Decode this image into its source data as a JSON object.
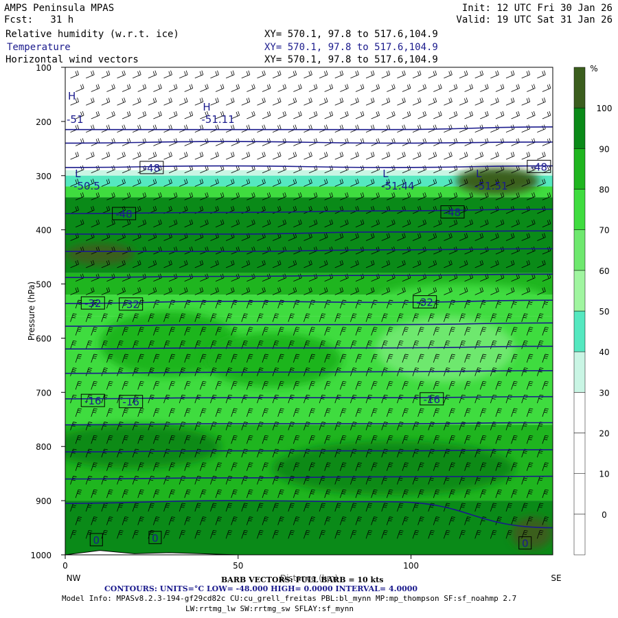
{
  "header": {
    "model": "AMPS Peninsula MPAS",
    "fcst": "Fcst:   31 h",
    "init": "Init: 12 UTC Fri 30 Jan 26",
    "valid": "Valid: 19 UTC Sat 31 Jan 26",
    "fields": [
      {
        "label": "Relative humidity (w.r.t. ice)",
        "xy": "XY= 570.1, 97.8 to 517.6,104.9",
        "color": "#000000"
      },
      {
        "label": "Temperature",
        "xy": "XY= 570.1, 97.8 to 517.6,104.9",
        "color": "#1a1a8c"
      },
      {
        "label": "Horizontal wind vectors",
        "xy": "XY= 570.1, 97.8 to 517.6,104.9",
        "color": "#000000"
      }
    ]
  },
  "axes": {
    "ylabel": "Pressure (hPa)",
    "xlabel": "Distance (km)",
    "left_end": "NW",
    "right_end": "SE",
    "colorbar_unit": "%"
  },
  "footer": {
    "barb": "BARB VECTORS: FULL BARB = 10 kts",
    "contours": "CONTOURS:  UNITS=°C  LOW=  -48.000        HIGH=  0.0000       INTERVAL=    4.0000",
    "model_info": "Model Info: MPASv8.2.3-194-gf29cd82c CU:cu_grell_freitas PBL:bl_mynn MP:mp_thompson SF:sf_noahmp 2.7",
    "model_info2": "LW:rrtmg_lw SW:rrtmg_sw SFLAY:sf_mynn"
  },
  "colors": {
    "rh_bands": [
      "#ffffff",
      "#ffffff",
      "#ffffff",
      "#ffffff",
      "#c9f5e4",
      "#55e8c0",
      "#a0f5a0",
      "#6ee86e",
      "#3fdc3f",
      "#1fb51f",
      "#0a8a18",
      "#3b5e1e"
    ],
    "temp_contour": "#1a1a8c"
  },
  "chart_data": {
    "type": "heatmap",
    "title": "Relative humidity (w.r.t. ice)",
    "xlabel": "Distance (km)",
    "ylabel": "Pressure (hPa)",
    "xlim": [
      0,
      141
    ],
    "ylim": [
      1000,
      100
    ],
    "x_ticks": [
      0,
      50,
      100
    ],
    "y_ticks": [
      100,
      200,
      300,
      400,
      500,
      600,
      700,
      800,
      900,
      1000
    ],
    "colorbar": {
      "unit": "%",
      "levels": [
        -10,
        0,
        10,
        20,
        30,
        40,
        50,
        60,
        70,
        80,
        90,
        100,
        110
      ],
      "tick_labels": [
        0,
        10,
        20,
        30,
        40,
        50,
        60,
        70,
        80,
        90,
        100
      ]
    },
    "rh_layers": [
      {
        "p_top": 100,
        "p_bot": 290,
        "rh": 5
      },
      {
        "p_top": 290,
        "p_bot": 300,
        "rh": 35
      },
      {
        "p_top": 300,
        "p_bot": 320,
        "rh": 45
      },
      {
        "p_top": 320,
        "p_bot": 340,
        "rh": 75
      },
      {
        "p_top": 340,
        "p_bot": 480,
        "rh": 95
      },
      {
        "p_top": 480,
        "p_bot": 520,
        "rh": 85
      },
      {
        "p_top": 520,
        "p_bot": 560,
        "rh": 75
      },
      {
        "p_top": 560,
        "p_bot": 760,
        "rh": 72
      },
      {
        "p_top": 760,
        "p_bot": 900,
        "rh": 88
      },
      {
        "p_top": 900,
        "p_bot": 1000,
        "rh": 92
      }
    ],
    "rh_patches": [
      {
        "x": 125,
        "p": 310,
        "rx": 12,
        "rp": 25,
        "rh": 105
      },
      {
        "x": 10,
        "p": 445,
        "rx": 10,
        "rp": 20,
        "rh": 105
      },
      {
        "x": 115,
        "p": 530,
        "rx": 25,
        "rp": 30,
        "rh": 70
      },
      {
        "x": 30,
        "p": 610,
        "rx": 20,
        "rp": 60,
        "rh": 80
      },
      {
        "x": 60,
        "p": 640,
        "rx": 20,
        "rp": 50,
        "rh": 80
      },
      {
        "x": 110,
        "p": 620,
        "rx": 20,
        "rp": 60,
        "rh": 65
      },
      {
        "x": 20,
        "p": 800,
        "rx": 25,
        "rp": 40,
        "rh": 95
      },
      {
        "x": 95,
        "p": 840,
        "rx": 35,
        "rp": 50,
        "rh": 95
      },
      {
        "x": 135,
        "p": 960,
        "rx": 6,
        "rp": 30,
        "rh": 105
      }
    ],
    "temperature_contours": {
      "units": "°C",
      "low": -48.0,
      "high": 0.0,
      "interval": 4.0,
      "lines": [
        {
          "t": -56,
          "p": [
            215,
            215,
            215,
            210
          ]
        },
        {
          "t": -52,
          "p": [
            240,
            237,
            240,
            238
          ]
        },
        {
          "t": -48,
          "p": [
            285,
            282,
            285,
            282
          ]
        },
        {
          "t": -48,
          "p": [
            370,
            368,
            365,
            362
          ]
        },
        {
          "t": -44,
          "p": [
            408,
            408,
            404,
            402
          ]
        },
        {
          "t": -40,
          "p": [
            440,
            440,
            437,
            435
          ]
        },
        {
          "t": -36,
          "p": [
            488,
            486,
            484,
            482
          ]
        },
        {
          "t": -32,
          "p": [
            536,
            532,
            534,
            530
          ]
        },
        {
          "t": -28,
          "p": [
            578,
            575,
            575,
            572
          ]
        },
        {
          "t": -24,
          "p": [
            620,
            618,
            618,
            615
          ]
        },
        {
          "t": -20,
          "p": [
            665,
            663,
            662,
            660
          ]
        },
        {
          "t": -16,
          "p": [
            712,
            710,
            710,
            708
          ]
        },
        {
          "t": -12,
          "p": [
            760,
            758,
            758,
            756
          ]
        },
        {
          "t": -8,
          "p": [
            810,
            808,
            808,
            806
          ]
        },
        {
          "t": -4,
          "p": [
            860,
            858,
            856,
            855
          ]
        },
        {
          "t": 0,
          "p": [
            905,
            900,
            902,
            950
          ]
        }
      ],
      "labels": [
        {
          "text": "-48",
          "x": 25,
          "p": 285
        },
        {
          "text": "-48",
          "x": 137,
          "p": 283
        },
        {
          "text": "-48",
          "x": 17,
          "p": 370
        },
        {
          "text": "-48",
          "x": 112,
          "p": 367
        },
        {
          "text": "-32",
          "x": 8,
          "p": 535
        },
        {
          "text": "-32",
          "x": 19,
          "p": 537
        },
        {
          "text": "-32",
          "x": 104,
          "p": 533
        },
        {
          "text": "-16",
          "x": 8,
          "p": 715
        },
        {
          "text": "-16",
          "x": 19,
          "p": 717
        },
        {
          "text": "-16",
          "x": 106,
          "p": 712
        },
        {
          "text": "0",
          "x": 9,
          "p": 972
        },
        {
          "text": "0",
          "x": 26,
          "p": 968
        },
        {
          "text": "0",
          "x": 133,
          "p": 978
        }
      ],
      "extrema": [
        {
          "mark": "H",
          "value": "",
          "x": 0,
          "p": 175
        },
        {
          "mark": "",
          "value": "-51",
          "x": 0,
          "p": 195
        },
        {
          "mark": "H",
          "value": "-51.11",
          "x": 39,
          "p": 195
        },
        {
          "mark": "L",
          "value": "-50.5",
          "x": 2,
          "p": 318
        },
        {
          "mark": "L",
          "value": "-51.44",
          "x": 91,
          "p": 318
        },
        {
          "mark": "L",
          "value": "-51.51",
          "x": 118,
          "p": 318
        }
      ]
    },
    "wind": {
      "full_barb_kts": 10,
      "x_spacing_km": 4.5,
      "levels_hpa": [
        120,
        145,
        170,
        195,
        220,
        245,
        270,
        295,
        320,
        345,
        370,
        395,
        420,
        445,
        470,
        495,
        520,
        545,
        570,
        595,
        620,
        645,
        670,
        695,
        720,
        745,
        770,
        795,
        820,
        845,
        870,
        895,
        920,
        945,
        970
      ]
    },
    "terrain": {
      "x": [
        0,
        10,
        20,
        30,
        50,
        80,
        110,
        141
      ],
      "p": [
        1000,
        992,
        998,
        996,
        1000,
        1000,
        1000,
        1000
      ]
    }
  }
}
